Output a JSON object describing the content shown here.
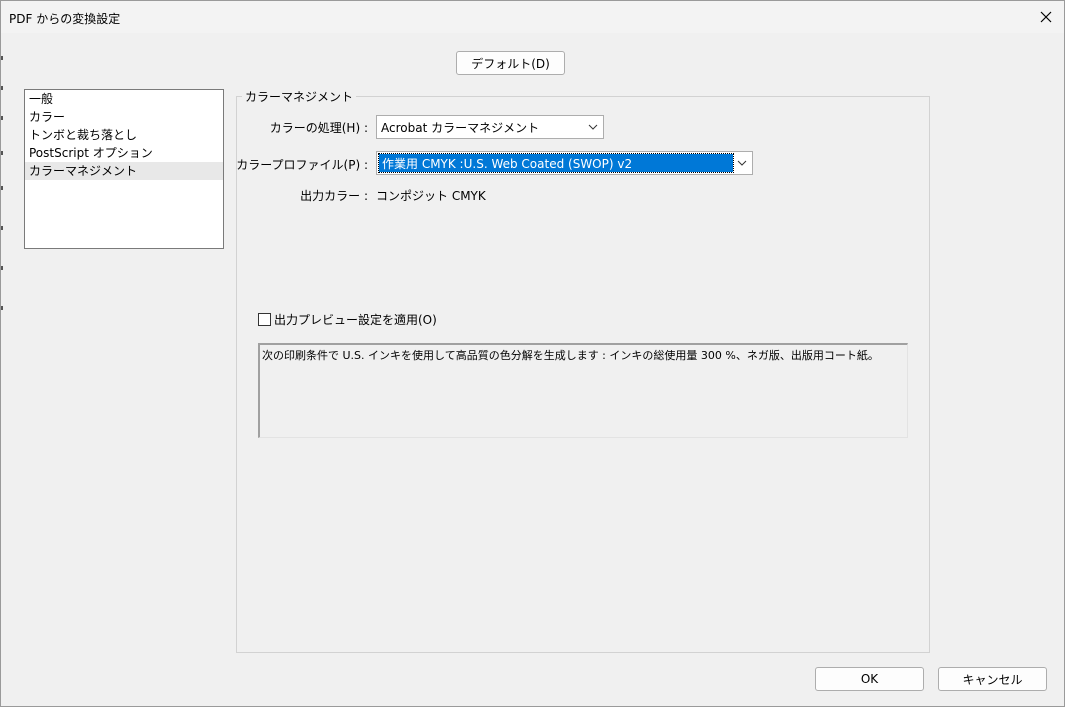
{
  "window": {
    "title": "PDF からの変換設定"
  },
  "toolbar": {
    "default_label": "デフォルト(D)"
  },
  "sidebar": {
    "items": [
      {
        "label": "一般"
      },
      {
        "label": "カラー"
      },
      {
        "label": "トンボと裁ち落とし"
      },
      {
        "label": "PostScript オプション"
      },
      {
        "label": "カラーマネジメント",
        "selected": true
      }
    ]
  },
  "color_mgmt": {
    "group_title": "カラーマネジメント",
    "handling_label": "カラーの処理(H) :",
    "handling_value": "Acrobat カラーマネジメント",
    "profile_label": "カラープロファイル(P) :",
    "profile_value": "作業用 CMYK :U.S. Web Coated (SWOP) v2",
    "output_label": "出力カラー :",
    "output_value": "コンポジット CMYK",
    "preview_checkbox_label": "出力プレビュー設定を適用(O)",
    "preview_checked": false,
    "description": "次の印刷条件で U.S. インキを使用して高品質の色分解を生成します : インキの総使用量 300 %、ネガ版、出版用コート紙。"
  },
  "footer": {
    "ok_label": "OK",
    "cancel_label": "キャンセル"
  },
  "colors": {
    "selection": "#0078d7",
    "background": "#f0f0f0"
  }
}
